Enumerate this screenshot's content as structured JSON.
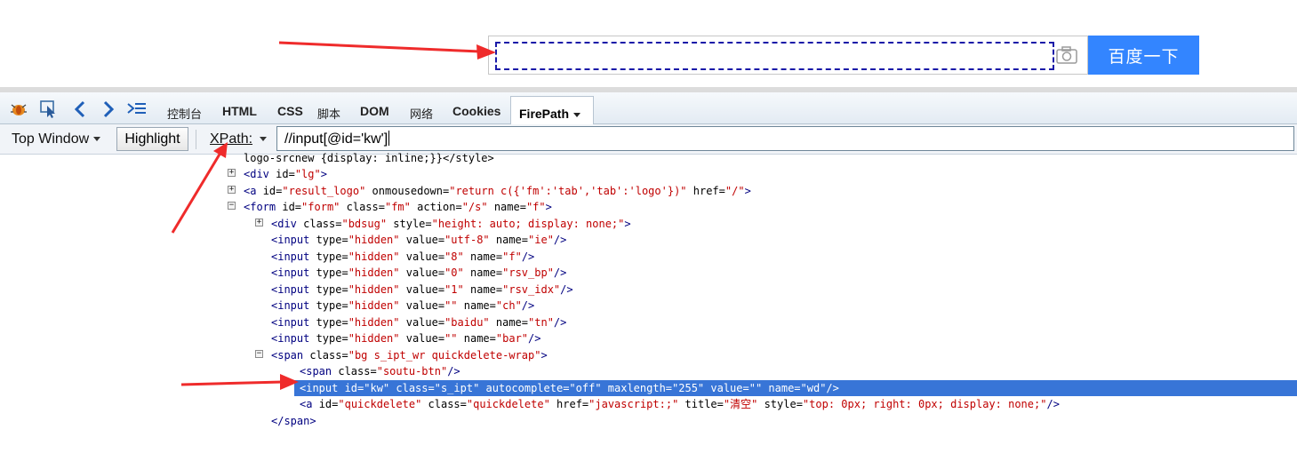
{
  "search": {
    "button_label": "百度一下",
    "input_value": ""
  },
  "firebug": {
    "tabs": [
      "控制台",
      "HTML",
      "CSS",
      "脚本",
      "DOM",
      "网络",
      "Cookies"
    ],
    "active_tab": "FirePath",
    "toolbar": {
      "frame_select": "Top Window",
      "highlight": "Highlight",
      "xpath_label": "XPath:",
      "xpath_value": "//input[@id='kw']"
    }
  },
  "tree": {
    "r0": "logo-srcnew {display: inline;}}</style>",
    "r1_tag": "<div ",
    "r1_a": "id=",
    "r1_v": "\"lg\"",
    "r1_e": ">",
    "r2_tag": "<a ",
    "r2_a1": "id=",
    "r2_v1": "\"result_logo\"",
    "r2_a2": " onmousedown=",
    "r2_v2": "\"return c({'fm':'tab','tab':'logo'})\"",
    "r2_a3": " href=",
    "r2_v3": "\"/\"",
    "r2_e": ">",
    "r3_tag": "<form ",
    "r3_a1": "id=",
    "r3_v1": "\"form\"",
    "r3_a2": " class=",
    "r3_v2": "\"fm\"",
    "r3_a3": " action=",
    "r3_v3": "\"/s\"",
    "r3_a4": " name=",
    "r3_v4": "\"f\"",
    "r3_e": ">",
    "r4_tag": "<div ",
    "r4_a1": "class=",
    "r4_v1": "\"bdsug\"",
    "r4_a2": " style=",
    "r4_v2": "\"height: auto; display: none;\"",
    "r4_e": ">",
    "inputs": [
      {
        "v1": "\"hidden\"",
        "v2": "\"utf-8\"",
        "v3": "\"ie\""
      },
      {
        "v1": "\"hidden\"",
        "v2": "\"8\"",
        "v3": "\"f\""
      },
      {
        "v1": "\"hidden\"",
        "v2": "\"0\"",
        "v3": "\"rsv_bp\""
      },
      {
        "v1": "\"hidden\"",
        "v2": "\"1\"",
        "v3": "\"rsv_idx\""
      },
      {
        "v1": "\"hidden\"",
        "v2": "\"\"",
        "v3": "\"ch\""
      },
      {
        "v1": "\"hidden\"",
        "v2": "\"baidu\"",
        "v3": "\"tn\""
      },
      {
        "v1": "\"hidden\"",
        "v2": "\"\"",
        "v3": "\"bar\""
      }
    ],
    "input_tag": "<input ",
    "type_attr": "type=",
    "value_attr": " value=",
    "name_attr": " name=",
    "close": "/>",
    "r12_tag": "<span ",
    "r12_a": "class=",
    "r12_v": "\"bg s_ipt_wr quickdelete-wrap\"",
    "r12_e": ">",
    "r13_tag": "<span ",
    "r13_a": "class=",
    "r13_v": "\"soutu-btn\"",
    "r13_e": "/>",
    "r14": "<input id=\"kw\" class=\"s_ipt\" autocomplete=\"off\" maxlength=\"255\" value=\"\" name=\"wd\"/>",
    "r15_tag": "<a ",
    "r15_a1": "id=",
    "r15_v1": "\"quickdelete\"",
    "r15_a2": " class=",
    "r15_v2": "\"quickdelete\"",
    "r15_a3": " href=",
    "r15_v3": "\"javascript:;\"",
    "r15_a4": " title=",
    "r15_v4": "\"清空\"",
    "r15_a5": " style=",
    "r15_v5": "\"top: 0px; right: 0px; display: none;\"",
    "r15_e": "/>",
    "r16": "</span>"
  }
}
